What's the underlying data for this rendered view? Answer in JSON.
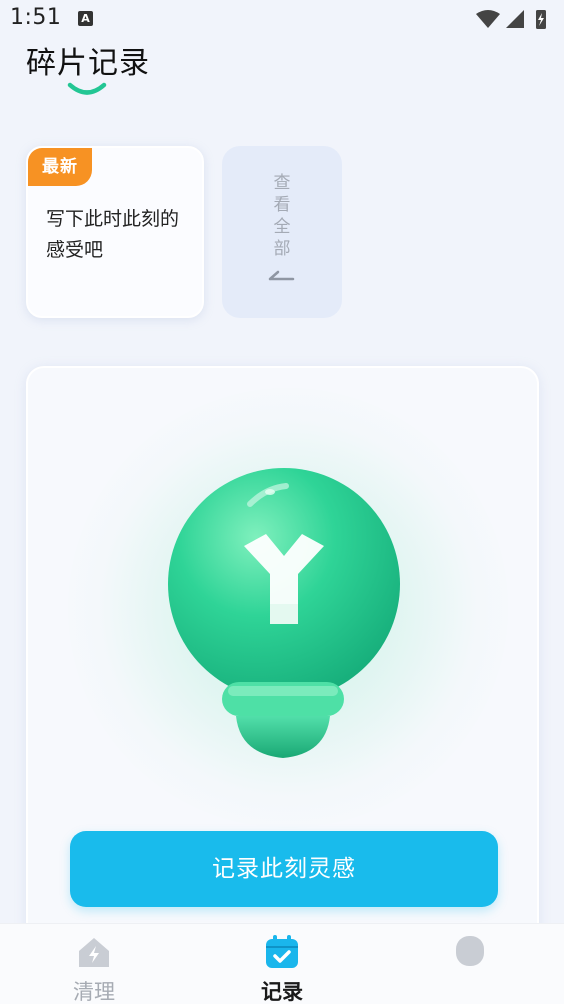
{
  "status_bar": {
    "time": "1:51",
    "notification_badge": "A",
    "icons": [
      "wifi-icon",
      "signal-icon",
      "battery-charging-icon"
    ]
  },
  "header": {
    "title": "碎片记录"
  },
  "latest_card": {
    "badge": "最新",
    "text": "写下此时此刻的感受吧"
  },
  "view_all": {
    "label": "查看全部",
    "icon": "arrow-left-icon"
  },
  "main": {
    "illustration": "lightbulb-icon",
    "button_label": "记录此刻灵感"
  },
  "bottom_nav": {
    "items": [
      {
        "label": "清理",
        "icon": "house-bolt-icon",
        "active": false
      },
      {
        "label": "记录",
        "icon": "calendar-check-icon",
        "active": true
      },
      {
        "label": "",
        "icon": "profile-icon",
        "active": false
      }
    ]
  },
  "colors": {
    "accent_green": "#2bd29b",
    "badge_orange": "#f79223",
    "button_blue": "#19bbec",
    "background": "#f1f4fb"
  }
}
